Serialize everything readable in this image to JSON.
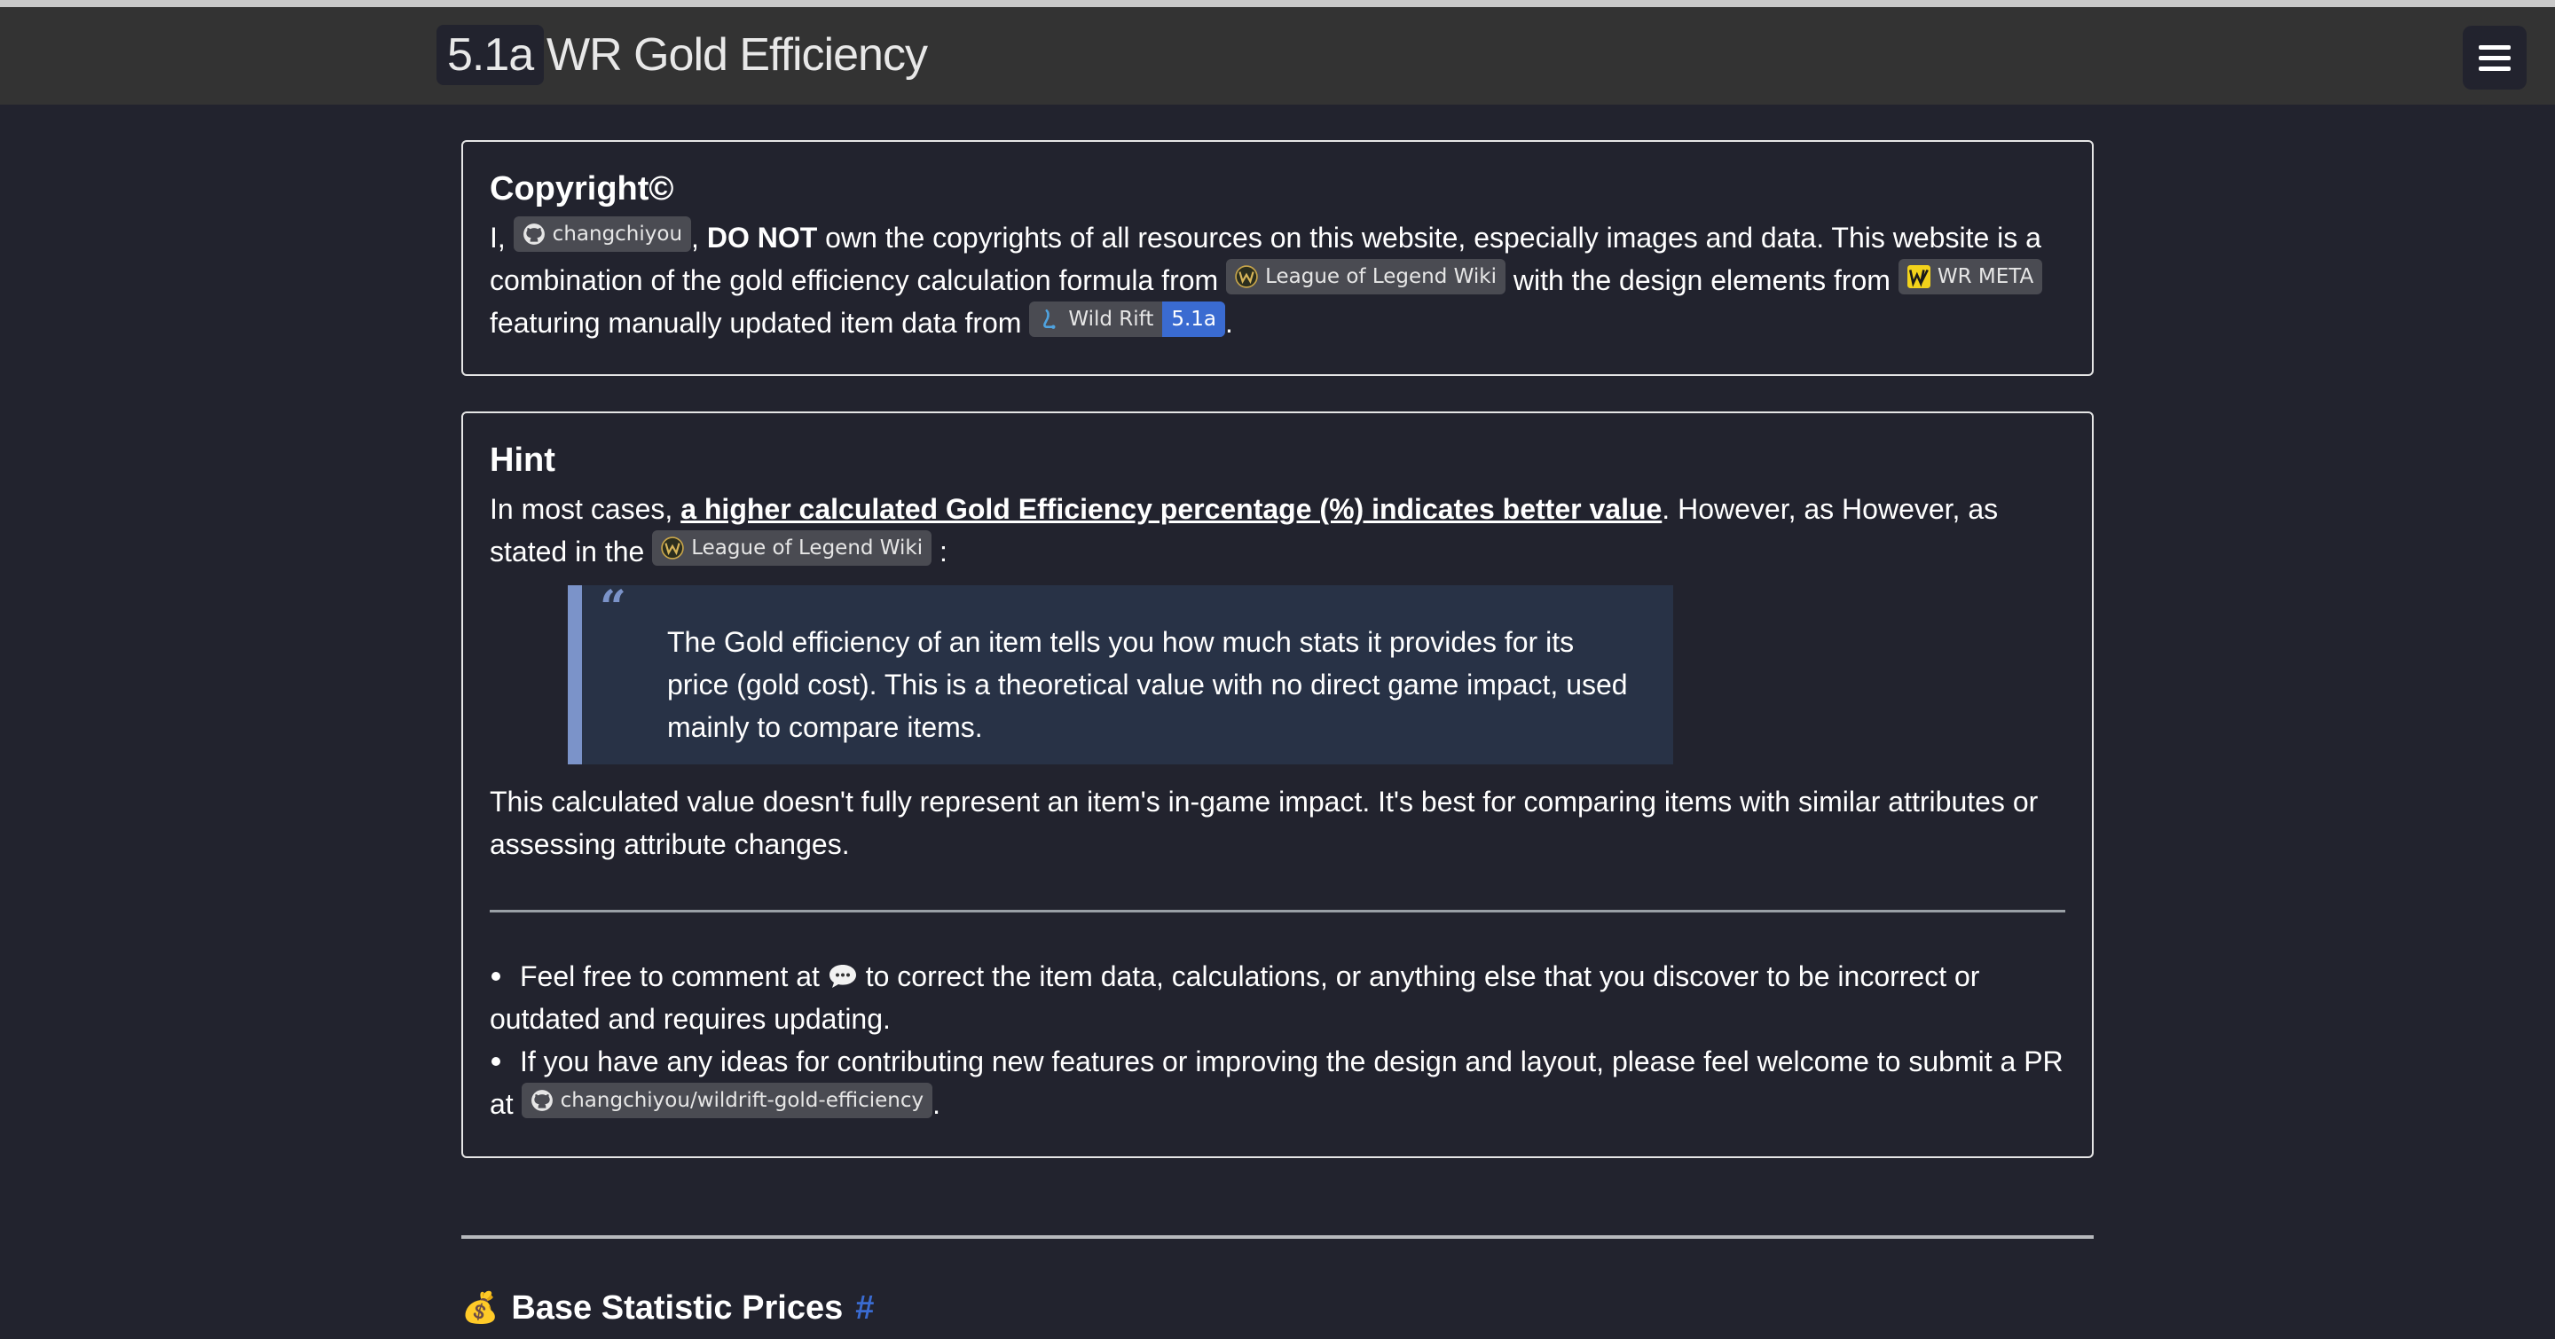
{
  "header": {
    "version": "5.1a",
    "title": "WR Gold Efficiency"
  },
  "copyright": {
    "title": "Copyright©",
    "t1": "I, ",
    "author_badge": "changchiyou",
    "t2": ", ",
    "do_not": "DO NOT",
    "t3": " own the copyrights of all resources on this website, especially images and data. This website is a combination of the gold efficiency calculation formula from ",
    "lol_wiki_badge": "League of Legend Wiki",
    "t4": " with the design elements from ",
    "wr_meta_badge": "WR META",
    "t5": " featuring manually updated item data from ",
    "wild_rift_badge": "Wild Rift",
    "wild_rift_version": "5.1a",
    "t6": "."
  },
  "hint": {
    "title": "Hint",
    "t1": "In most cases, ",
    "emphasis": "a higher calculated Gold Efficiency percentage (%) indicates better value",
    "t2": ". However, as However, as stated in the ",
    "lol_wiki_badge": "League of Legend Wiki",
    "t3": " :",
    "quote": "The Gold efficiency of an item tells you how much stats it provides for its price (gold cost). This is a theoretical value with no direct game impact, used mainly to compare items.",
    "after_quote": "This calculated value doesn't fully represent an item's in-game impact. It's best for comparing items with similar attributes or assessing attribute changes.",
    "tip1_a": "Feel free to comment at ",
    "tip1_b": " to correct the item data, calculations, or anything else that you discover to be incorrect or outdated and requires updating.",
    "tip2_a": "If you have any ideas for contributing new features or improving the design and layout, please feel welcome to submit a PR at ",
    "repo_badge": "changchiyou/wildrift-gold-efficiency",
    "tip2_b": "."
  },
  "section": {
    "emoji": "💰",
    "title": "Base Statistic Prices",
    "anchor": "#"
  },
  "colors": {
    "background": "#22232e",
    "navbar": "#333333",
    "badge": "#4a4b52",
    "accent": "#3a6bd1",
    "quote_bg": "#283246",
    "quote_border": "#7b93c9"
  }
}
